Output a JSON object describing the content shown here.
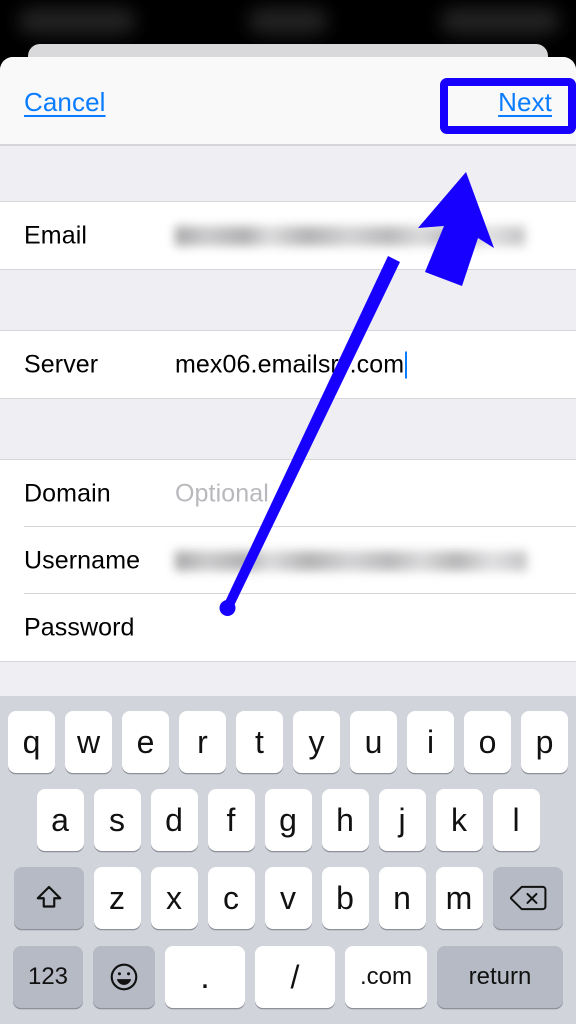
{
  "statusbar": {
    "blurred": true,
    "left_text": "",
    "center_text": "",
    "right_text": ""
  },
  "navbar": {
    "cancel_label": "Cancel",
    "next_label": "Next",
    "accent_color": "#0a7cff"
  },
  "form": {
    "rows": [
      {
        "label": "Email",
        "value": "",
        "placeholder": "",
        "redacted": true
      },
      {
        "label": "Server",
        "value": "mex06.emailsrv.com",
        "placeholder": "",
        "redacted": false
      },
      {
        "label": "Domain",
        "value": "",
        "placeholder": "Optional",
        "redacted": false
      },
      {
        "label": "Username",
        "value": "",
        "placeholder": "",
        "redacted": true
      },
      {
        "label": "Password",
        "value": "",
        "placeholder": "",
        "redacted": false
      }
    ]
  },
  "keyboard": {
    "row1": [
      "q",
      "w",
      "e",
      "r",
      "t",
      "y",
      "u",
      "i",
      "o",
      "p"
    ],
    "row2": [
      "a",
      "s",
      "d",
      "f",
      "g",
      "h",
      "j",
      "k",
      "l"
    ],
    "row3": [
      "z",
      "x",
      "c",
      "v",
      "b",
      "n",
      "m"
    ],
    "shift_icon": "shift-icon",
    "delete_icon": "delete-icon",
    "numbers_label": "123",
    "emoji_icon": "emoji-icon",
    "period_label": ".",
    "slash_label": "/",
    "dotcom_label": ".com",
    "return_label": "return"
  },
  "annotations": {
    "highlight_color": "#1800ff",
    "arrow_color": "#1800ff",
    "highlight_target": "Next",
    "arrow_from": "220,604",
    "arrow_to": "466,172"
  }
}
